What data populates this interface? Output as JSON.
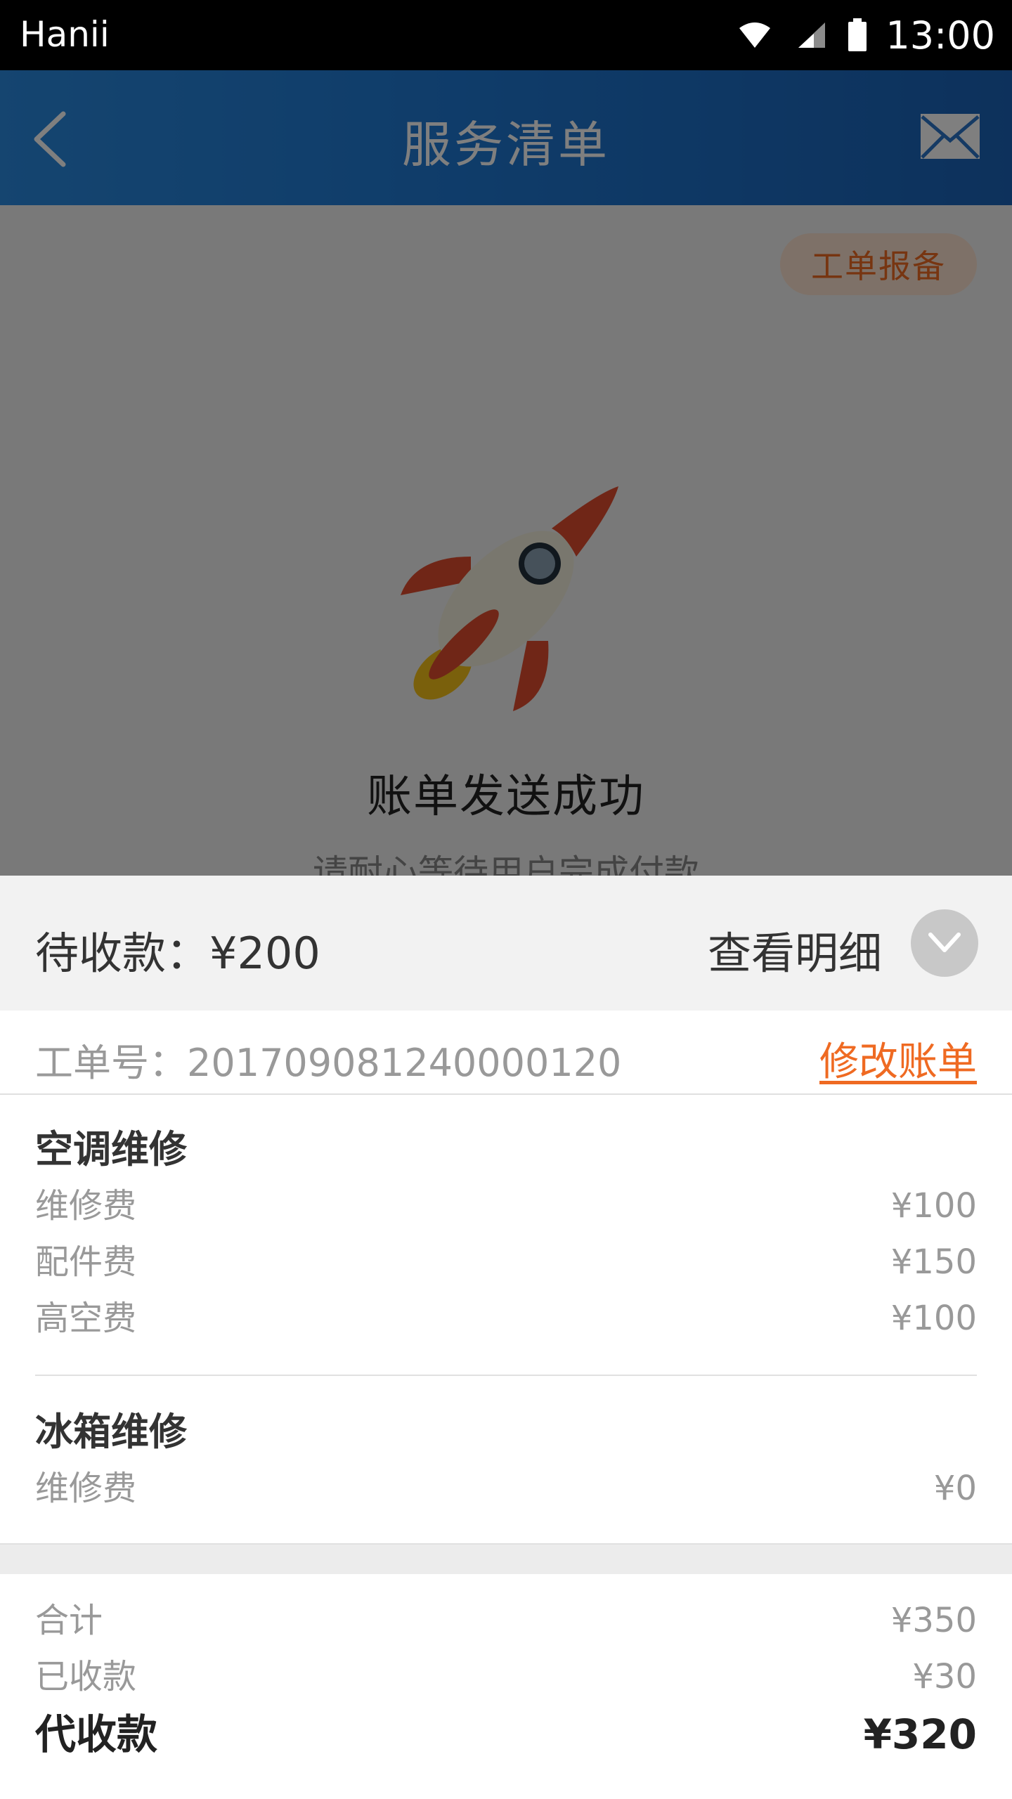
{
  "status_bar": {
    "carrier": "Hanii",
    "time": "13:00"
  },
  "nav": {
    "title": "服务清单"
  },
  "main": {
    "report_button": "工单报备",
    "success_title": "账单发送成功",
    "success_subtitle": "请耐心等待用户完成付款"
  },
  "sheet": {
    "pending": "待收款：¥200",
    "view_detail": "查看明细",
    "order_no": "工单号：201709081240000120",
    "edit_bill": "修改账单",
    "services": [
      {
        "name": "空调维修",
        "fees": [
          {
            "label": "维修费",
            "amount": "¥100"
          },
          {
            "label": "配件费",
            "amount": "¥150"
          },
          {
            "label": "高空费",
            "amount": "¥100"
          }
        ]
      },
      {
        "name": "冰箱维修",
        "fees": [
          {
            "label": "维修费",
            "amount": "¥0"
          }
        ]
      }
    ],
    "totals": {
      "total_label": "合计",
      "total_amount": "¥350",
      "received_label": "已收款",
      "received_amount": "¥30",
      "collect_label": "代收款",
      "collect_amount": "¥320"
    }
  },
  "colors": {
    "accent_orange": "#ef6a22",
    "nav_blue": "#1f79d4"
  }
}
